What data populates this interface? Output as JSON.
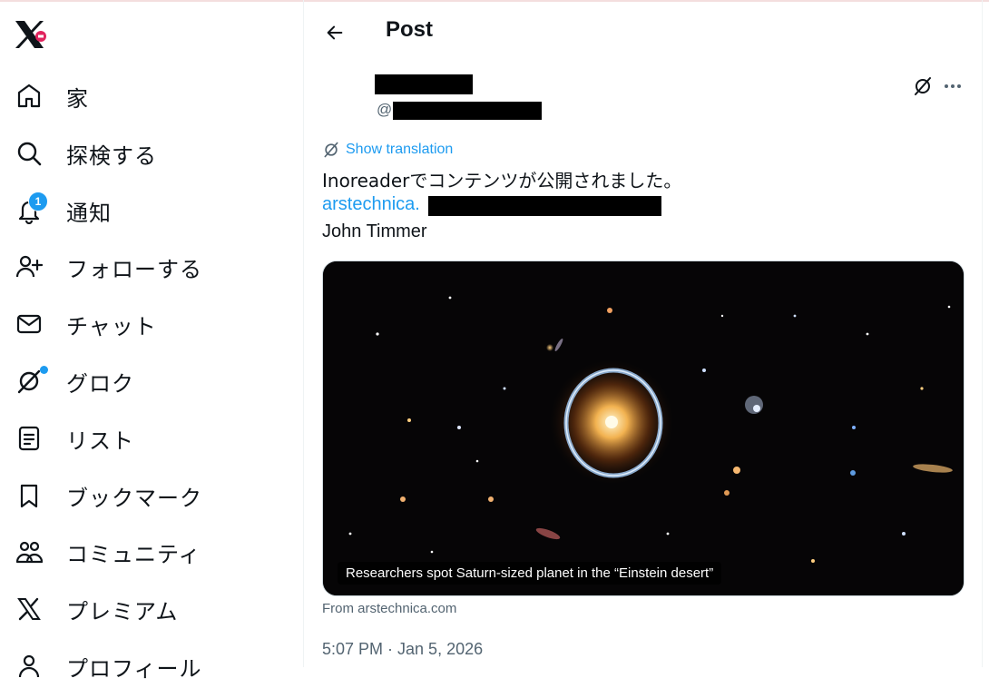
{
  "app": {
    "logo_icon": "x-logo-icon",
    "accent": "#1d9bf0"
  },
  "sidebar": {
    "items": [
      {
        "key": "home",
        "label": "家",
        "icon": "home-icon"
      },
      {
        "key": "explore",
        "label": "探検する",
        "icon": "search-icon"
      },
      {
        "key": "notifications",
        "label": "通知",
        "icon": "bell-icon",
        "badge": "1"
      },
      {
        "key": "follow",
        "label": "フォローする",
        "icon": "person-add-icon"
      },
      {
        "key": "chat",
        "label": "チャット",
        "icon": "mail-icon"
      },
      {
        "key": "grok",
        "label": "グロク",
        "icon": "grok-icon"
      },
      {
        "key": "lists",
        "label": "リスト",
        "icon": "list-icon"
      },
      {
        "key": "bookmarks",
        "label": "ブックマーク",
        "icon": "bookmark-icon"
      },
      {
        "key": "communities",
        "label": "コミュニティ",
        "icon": "people-icon"
      },
      {
        "key": "premium",
        "label": "プレミアム",
        "icon": "x-icon"
      },
      {
        "key": "profile",
        "label": "プロフィール",
        "icon": "person-icon"
      }
    ]
  },
  "header": {
    "title": "Post"
  },
  "post": {
    "handle_prefix": "@",
    "translate_label": "Show translation",
    "text_line": "Inoreaderでコンテンツが公開されました。",
    "link_text": "arstechnica.",
    "author_line": "John Timmer",
    "card": {
      "caption": "Researchers spot Saturn-sized planet in the “Einstein desert”",
      "source": "From arstechnica.com"
    },
    "timestamp": "5:07 PM · Jan 5, 2026"
  }
}
